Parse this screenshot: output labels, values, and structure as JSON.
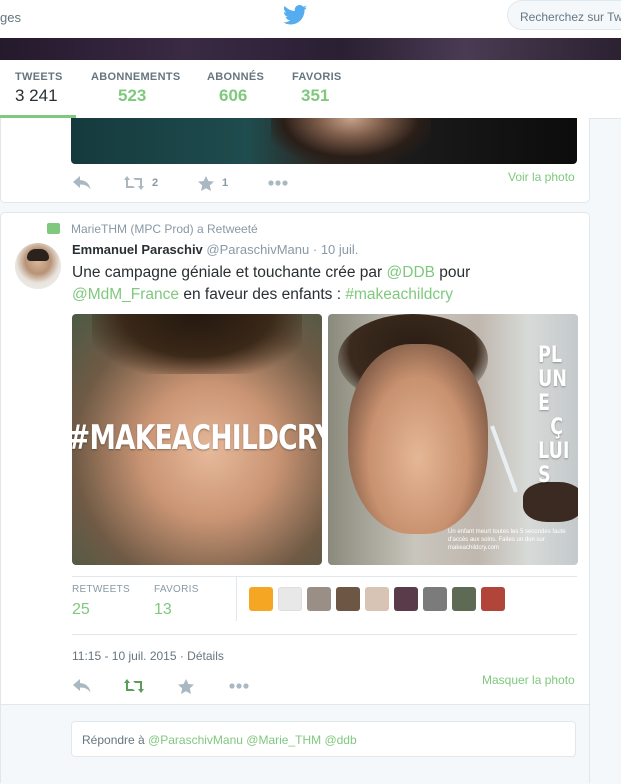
{
  "topbar": {
    "nav_label": "ges",
    "logo_icon": "twitter-bird-icon",
    "search_placeholder": "Recherchez sur Twitter"
  },
  "profile_nav": {
    "stats": [
      {
        "label": "TWEETS",
        "value": "3 241",
        "active": true
      },
      {
        "label": "ABONNEMENTS",
        "value": "523"
      },
      {
        "label": "ABONNÉS",
        "value": "606"
      },
      {
        "label": "FAVORIS",
        "value": "351"
      }
    ]
  },
  "tweet1": {
    "retweet_count": "2",
    "favorite_count": "1",
    "photo_link": "Voir la photo"
  },
  "tweet2": {
    "retweet_context": "MarieTHM (MPC Prod) a Retweeté",
    "fullname": "Emmanuel Paraschiv",
    "handle": "@ParaschivManu",
    "time": "10 juil.",
    "text_1": "Une campagne géniale et touchante crée par ",
    "mention_ddb": "@DDB",
    "text_2": " pour ",
    "mention_mdm": "@MdM_France",
    "text_3": " en faveur des enfants : ",
    "hashtag": "#makeachildcry",
    "media_left_text": "#MAKEACHILDCRY",
    "media_right_text": "PL\nUN E\nÇ\nLUI S",
    "media_right_caption": "Un enfant meurt toutes les 5 secondes faute d'accès aux soins. Faites un don sur makeachildcry.com",
    "stats": {
      "retweets_label": "RETWEETS",
      "retweets_value": "25",
      "favorites_label": "FAVORIS",
      "favorites_value": "13"
    },
    "timestamp": "11:15 - 10 juil. 2015 · Détails",
    "hide_photo": "Masquer la photo",
    "reply_placeholder_prefix": "Répondre à ",
    "reply_mentions": "@ParaschivManu @Marie_THM @ddb"
  },
  "colors": {
    "accent": "#7fc87e",
    "muted": "#8899a6",
    "text": "#292f33",
    "twitter_blue": "#55acee"
  }
}
